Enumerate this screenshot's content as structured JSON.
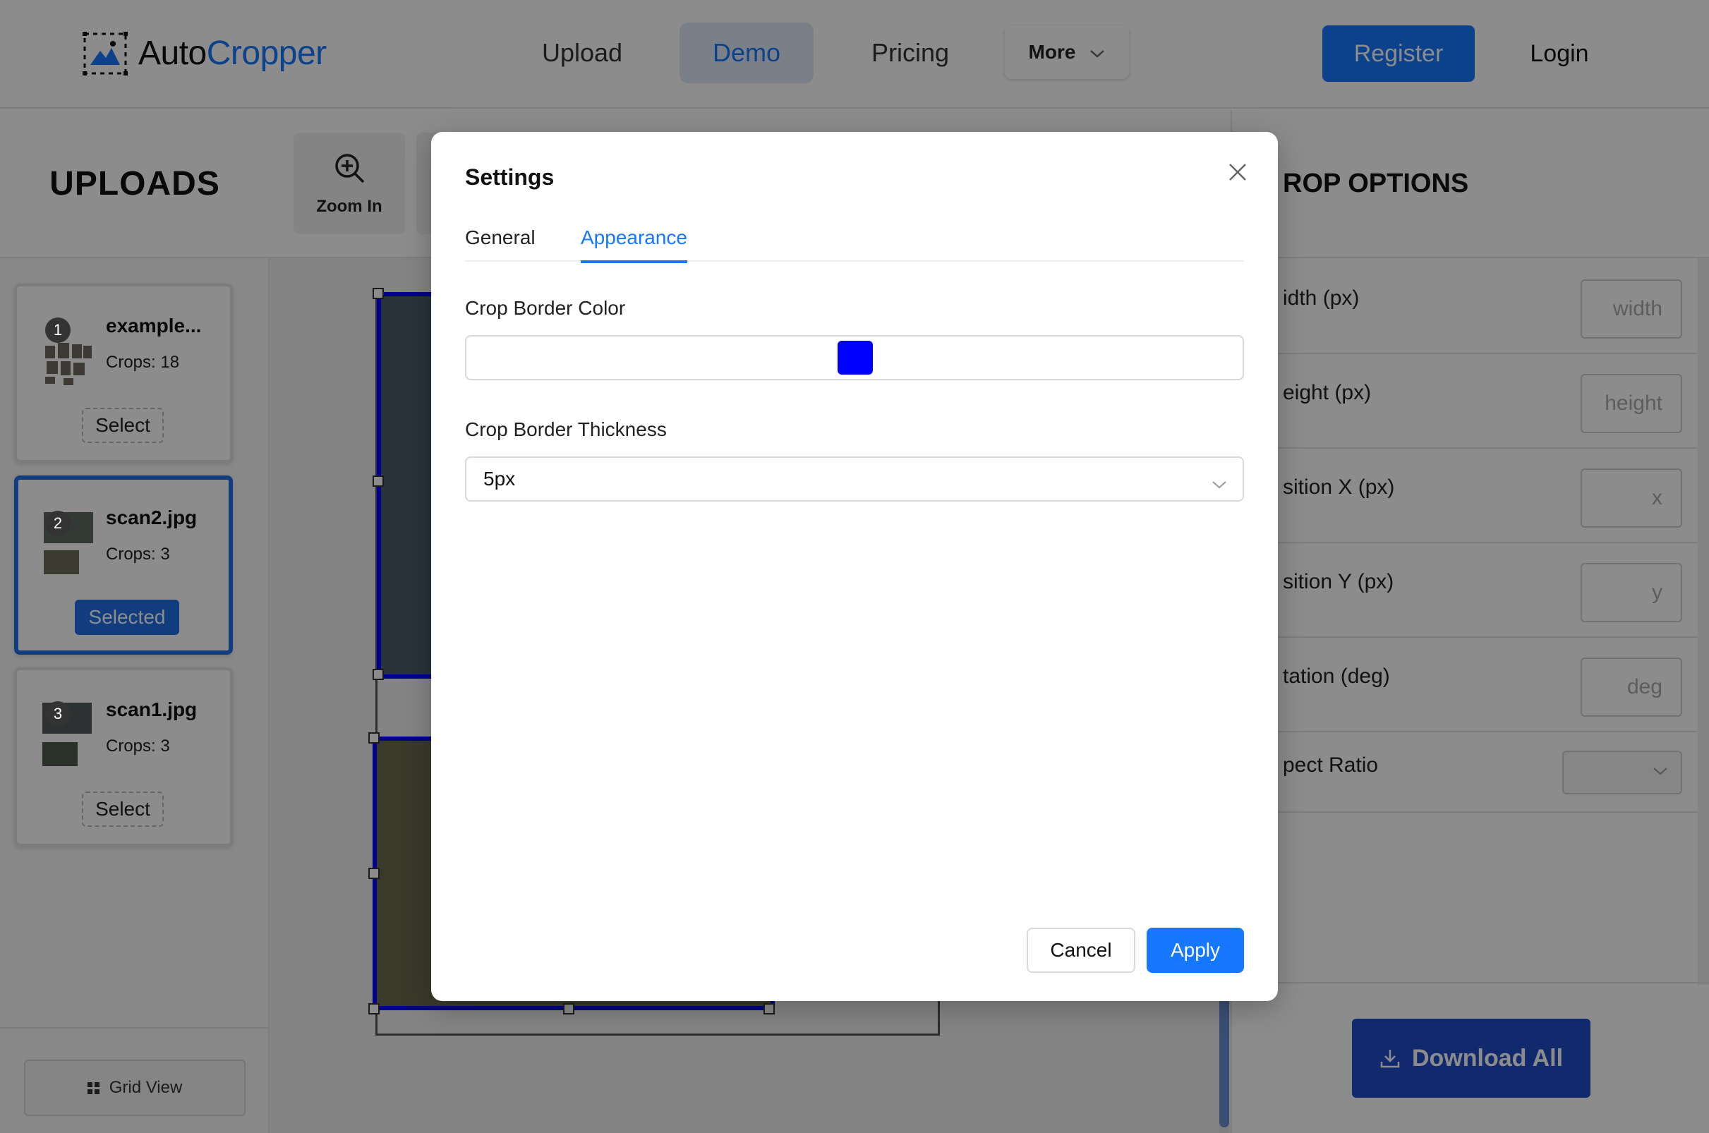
{
  "header": {
    "logo_part1": "Auto",
    "logo_part2": "Cropper",
    "nav": {
      "upload": "Upload",
      "demo": "Demo",
      "pricing": "Pricing",
      "more": "More"
    },
    "register": "Register",
    "login": "Login"
  },
  "uploads": {
    "title": "UPLOADS",
    "items": [
      {
        "number": "1",
        "name": "example...",
        "crops": "Crops: 18",
        "action": "Select"
      },
      {
        "number": "2",
        "name": "scan2.jpg",
        "crops": "Crops: 3",
        "action": "Selected"
      },
      {
        "number": "3",
        "name": "scan1.jpg",
        "crops": "Crops: 3",
        "action": "Select"
      }
    ],
    "grid_view": "Grid View"
  },
  "toolbar": {
    "zoom_in": "Zoom In"
  },
  "crop_options": {
    "title": "ROP OPTIONS",
    "rows": [
      {
        "label": "idth (px)",
        "placeholder": "width"
      },
      {
        "label": "eight (px)",
        "placeholder": "height"
      },
      {
        "label": "sition X (px)",
        "placeholder": "x"
      },
      {
        "label": "sition Y (px)",
        "placeholder": "y"
      },
      {
        "label": "tation (deg)",
        "placeholder": "deg"
      }
    ],
    "aspect_label": "pect Ratio",
    "download_all": "Download All"
  },
  "modal": {
    "title": "Settings",
    "tabs": {
      "general": "General",
      "appearance": "Appearance"
    },
    "active_tab": "Appearance",
    "crop_border_color_label": "Crop Border Color",
    "crop_border_color": "#0000ff",
    "crop_border_thickness_label": "Crop Border Thickness",
    "crop_border_thickness": "5px",
    "cancel": "Cancel",
    "apply": "Apply"
  },
  "colors": {
    "accent": "#1677ff",
    "crop_border": "#0000ff",
    "selected_card": "#1f6fe8",
    "download_button": "#1f4ec9"
  },
  "icons": {
    "logo": "crop-mountain-icon",
    "more_chevron": "chevron-down-icon",
    "zoom_in": "zoom-in-icon",
    "grid_view": "grid-icon",
    "download": "download-icon",
    "close": "close-icon",
    "select_chevron": "chevron-down-icon"
  }
}
